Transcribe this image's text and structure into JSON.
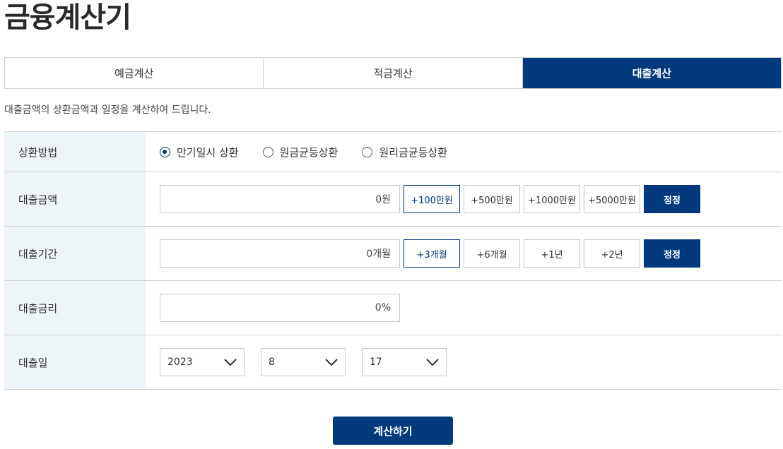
{
  "page_title": "금융계산기",
  "tabs": [
    {
      "label": "예금계산",
      "active": false
    },
    {
      "label": "적금계산",
      "active": false
    },
    {
      "label": "대출계산",
      "active": true
    }
  ],
  "description": "대출금액의 상환금액과 일정을 계산하여 드립니다.",
  "repayment": {
    "label": "상환방법",
    "options": [
      "만기일시 상환",
      "원금균등상환",
      "원리금균등상환"
    ],
    "selected": "만기일시 상환"
  },
  "amount": {
    "label": "대출금액",
    "value": "0원",
    "increments": [
      "+100만원",
      "+500만원",
      "+1000만원",
      "+5000만원"
    ],
    "reset_label": "정정"
  },
  "period": {
    "label": "대출기간",
    "value": "0개월",
    "increments": [
      "+3개월",
      "+6개월",
      "+1년",
      "+2년"
    ],
    "reset_label": "정정"
  },
  "rate": {
    "label": "대출금리",
    "value": "0%"
  },
  "date": {
    "label": "대출일",
    "year": "2023",
    "month": "8",
    "day": "17"
  },
  "submit_label": "계산하기",
  "colors": {
    "primary": "#003a7d",
    "label_bg": "#eef5f8",
    "border": "#cfcfcf"
  }
}
